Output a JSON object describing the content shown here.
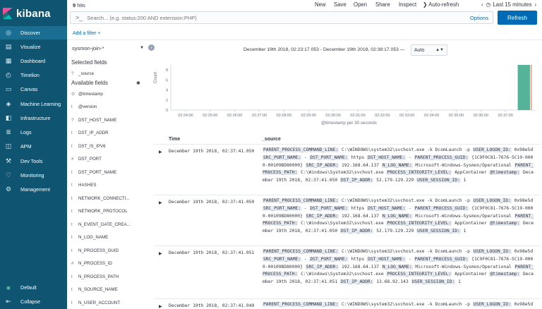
{
  "sidebar": {
    "logo_text": "kibana",
    "items": [
      {
        "label": "Discover",
        "icon": "compass-icon",
        "active": true
      },
      {
        "label": "Visualize",
        "icon": "bar-chart-icon"
      },
      {
        "label": "Dashboard",
        "icon": "dashboard-icon"
      },
      {
        "label": "Timelion",
        "icon": "timelion-icon"
      },
      {
        "label": "Canvas",
        "icon": "canvas-icon"
      },
      {
        "label": "Machine Learning",
        "icon": "ml-icon"
      },
      {
        "label": "Infrastructure",
        "icon": "infrastructure-icon"
      },
      {
        "label": "Logs",
        "icon": "logs-icon"
      },
      {
        "label": "APM",
        "icon": "apm-icon"
      },
      {
        "label": "Dev Tools",
        "icon": "wrench-icon"
      },
      {
        "label": "Monitoring",
        "icon": "monitoring-icon"
      },
      {
        "label": "Management",
        "icon": "gear-icon"
      }
    ],
    "bottom": [
      {
        "label": "Default",
        "icon": "space-icon"
      },
      {
        "label": "Collapse",
        "icon": "collapse-icon"
      }
    ]
  },
  "topbar": {
    "hits_count": "9",
    "hits_label": "hits",
    "menu": [
      "New",
      "Save",
      "Open",
      "Share",
      "Inspect"
    ],
    "auto_refresh": "Auto-refresh",
    "time_label": "Last 15 minutes"
  },
  "search": {
    "placeholder": "Search... (e.g. status:200 AND extension:PHP)",
    "value": "",
    "options_label": "Options",
    "refresh_label": "Refresh"
  },
  "filter": {
    "add_label": "Add a filter +"
  },
  "index_pattern": "sysmon-join-*",
  "fields": {
    "selected_title": "Selected fields",
    "selected": [
      {
        "type": "?",
        "name": "_source"
      }
    ],
    "available_title": "Available fields",
    "available": [
      {
        "type": "⊙",
        "name": "@timestamp"
      },
      {
        "type": "t",
        "name": "@version"
      },
      {
        "type": "?",
        "name": "DST_HOST_NAME"
      },
      {
        "type": "t",
        "name": "DST_IP_ADDR"
      },
      {
        "type": "t",
        "name": "DST_IS_IPV6"
      },
      {
        "type": "#",
        "name": "DST_PORT"
      },
      {
        "type": "t",
        "name": "DST_PORT_NAME"
      },
      {
        "type": "t",
        "name": "HASHES"
      },
      {
        "type": "t",
        "name": "NETWORK_CONNECTI..."
      },
      {
        "type": "t",
        "name": "NETWORK_PROTOCOL"
      },
      {
        "type": "t",
        "name": "N_EVENT_DATE_CREA..."
      },
      {
        "type": "t",
        "name": "N_LOG_NAME"
      },
      {
        "type": "t",
        "name": "N_PROCESS_GUID"
      },
      {
        "type": "#",
        "name": "N_PROCESS_ID"
      },
      {
        "type": "t",
        "name": "N_PROCESS_PATH"
      },
      {
        "type": "t",
        "name": "N_SOURCE_NAME"
      },
      {
        "type": "t",
        "name": "N_USER_ACCOUNT"
      }
    ]
  },
  "main": {
    "time_range": "December 19th 2018, 02:23:17.053 - December 19th 2018, 02:38:17.053 —",
    "interval": "Auto",
    "doc_headers": {
      "time": "Time",
      "source": "_source"
    }
  },
  "chart_data": {
    "type": "bar",
    "x_ticks": [
      "02:24:00",
      "02:25:00",
      "02:26:00",
      "02:27:00",
      "02:28:00",
      "02:29:00",
      "02:30:00",
      "02:31:00",
      "02:32:00",
      "02:33:00",
      "02:34:00",
      "02:35:00",
      "02:36:00",
      "02:37:00"
    ],
    "y_ticks": [
      0,
      2,
      4,
      6,
      8
    ],
    "ylim": [
      0,
      9
    ],
    "bars": [
      {
        "x": "02:37:30",
        "value": 9
      }
    ],
    "ylabel": "Count",
    "xlabel": "@timestamp per 30 seconds",
    "bar_color": "#54b399",
    "now_marker_color": "#e7664c"
  },
  "documents": [
    {
      "time": "December 19th 2018, 02:37:41.050",
      "source": [
        {
          "k": "PARENT_PROCESS_COMMAND_LINE:",
          "v": " C:\\WINDOWS\\system32\\svchost.exe -k DcomLaunch -p "
        },
        {
          "k": "USER_LOGON_ID:",
          "v": " 0x98e5d "
        },
        {
          "k": "SRC_PORT_NAME:",
          "v": " - "
        },
        {
          "k": "DST_PORT_NAME:",
          "v": " https "
        },
        {
          "k": "DST_HOST_NAME:",
          "v": " - "
        },
        {
          "k": "PARENT_PROCESS_GUID:",
          "v": " {1C9F0C81-7676-5C19-0000-00109BD80000} "
        },
        {
          "k": "SRC_IP_ADDR:",
          "v": " 192.168.64.137 "
        },
        {
          "k": "N_LOG_NAME:",
          "v": " Microsoft-Windows-Sysmon/Operational "
        },
        {
          "k": "PARENT_PROCESS_PATH:",
          "v": " C:\\Windows\\System32\\svchost.exe "
        },
        {
          "k": "PROCESS_INTEGRITY_LEVEL:",
          "v": " AppContainer "
        },
        {
          "k": "@timestamp:",
          "v": " December 19th 2018, 02:37:41.050 "
        },
        {
          "k": "DST_IP_ADDR:",
          "v": " 52.179.129.229 "
        },
        {
          "k": "USER_SESSION_ID:",
          "v": " 1"
        }
      ]
    },
    {
      "time": "December 19th 2018, 02:37:41.050",
      "source": [
        {
          "k": "PARENT_PROCESS_COMMAND_LINE:",
          "v": " C:\\WINDOWS\\system32\\svchost.exe -k DcomLaunch -p "
        },
        {
          "k": "USER_LOGON_ID:",
          "v": " 0x98e5d "
        },
        {
          "k": "SRC_PORT_NAME:",
          "v": " - "
        },
        {
          "k": "DST_PORT_NAME:",
          "v": " https "
        },
        {
          "k": "DST_HOST_NAME:",
          "v": " - "
        },
        {
          "k": "PARENT_PROCESS_GUID:",
          "v": " {1C9F0C81-7676-5C19-0000-00109BD80000} "
        },
        {
          "k": "SRC_IP_ADDR:",
          "v": " 192.168.64.137 "
        },
        {
          "k": "N_LOG_NAME:",
          "v": " Microsoft-Windows-Sysmon/Operational "
        },
        {
          "k": "PARENT_PROCESS_PATH:",
          "v": " C:\\Windows\\System32\\svchost.exe "
        },
        {
          "k": "PROCESS_INTEGRITY_LEVEL:",
          "v": " AppContainer "
        },
        {
          "k": "@timestamp:",
          "v": " December 19th 2018, 02:37:41.050 "
        },
        {
          "k": "DST_IP_ADDR:",
          "v": " 52.179.129.229 "
        },
        {
          "k": "USER_SESSION_ID:",
          "v": " 1"
        }
      ]
    },
    {
      "time": "December 19th 2018, 02:37:41.051",
      "source": [
        {
          "k": "PARENT_PROCESS_COMMAND_LINE:",
          "v": " C:\\WINDOWS\\system32\\svchost.exe -k DcomLaunch -p "
        },
        {
          "k": "USER_LOGON_ID:",
          "v": " 0x98e5d "
        },
        {
          "k": "SRC_PORT_NAME:",
          "v": " - "
        },
        {
          "k": "DST_PORT_NAME:",
          "v": " https "
        },
        {
          "k": "DST_HOST_NAME:",
          "v": " - "
        },
        {
          "k": "PARENT_PROCESS_GUID:",
          "v": " {1C9F0C81-7676-5C19-0000-00109BD80000} "
        },
        {
          "k": "SRC_IP_ADDR:",
          "v": " 192.168.64.137 "
        },
        {
          "k": "N_LOG_NAME:",
          "v": " Microsoft-Windows-Sysmon/Operational "
        },
        {
          "k": "PARENT_PROCESS_PATH:",
          "v": " C:\\Windows\\System32\\svchost.exe "
        },
        {
          "k": "PROCESS_INTEGRITY_LEVEL:",
          "v": " AppContainer "
        },
        {
          "k": "@timestamp:",
          "v": " December 19th 2018, 02:37:41.051 "
        },
        {
          "k": "DST_IP_ADDR:",
          "v": " 13.68.92.143 "
        },
        {
          "k": "USER_SESSION_ID:",
          "v": " 1"
        }
      ]
    },
    {
      "time": "December 19th 2018, 02:37:41.049",
      "source": [
        {
          "k": "PARENT_PROCESS_COMMAND_LINE:",
          "v": " C:\\WINDOWS\\system32\\svchost.exe -k DcomLaunch -p "
        },
        {
          "k": "USER_LOGON_ID:",
          "v": " 0x98e5d"
        }
      ]
    }
  ]
}
